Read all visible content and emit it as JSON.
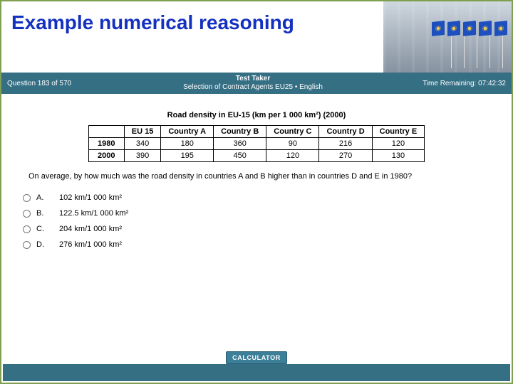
{
  "title": "Example numerical reasoning",
  "bar": {
    "question_counter": "Question 183 of 570",
    "center_line1": "Test Taker",
    "center_line2": "Selection of Contract Agents EU25 • English",
    "time_remaining": "Time Remaining: 07:42:32"
  },
  "chart_data": {
    "type": "table",
    "title": "Road density in EU-15 (km per 1 000 km²) (2000)",
    "columns": [
      "EU 15",
      "Country A",
      "Country B",
      "Country C",
      "Country D",
      "Country E"
    ],
    "rows": [
      {
        "year": "1980",
        "values": [
          340,
          180,
          360,
          90,
          216,
          120
        ]
      },
      {
        "year": "2000",
        "values": [
          390,
          195,
          450,
          120,
          270,
          130
        ]
      }
    ]
  },
  "question": "On average, by how much was the road density in countries A and B higher than in countries D and E in 1980?",
  "options": [
    {
      "key": "A.",
      "text": "102 km/1 000 km²"
    },
    {
      "key": "B.",
      "text": "122.5 km/1 000 km²"
    },
    {
      "key": "C.",
      "text": "204 km/1 000 km²"
    },
    {
      "key": "D.",
      "text": "276 km/1 000 km²"
    }
  ],
  "calculator_label": "CALCULATOR"
}
